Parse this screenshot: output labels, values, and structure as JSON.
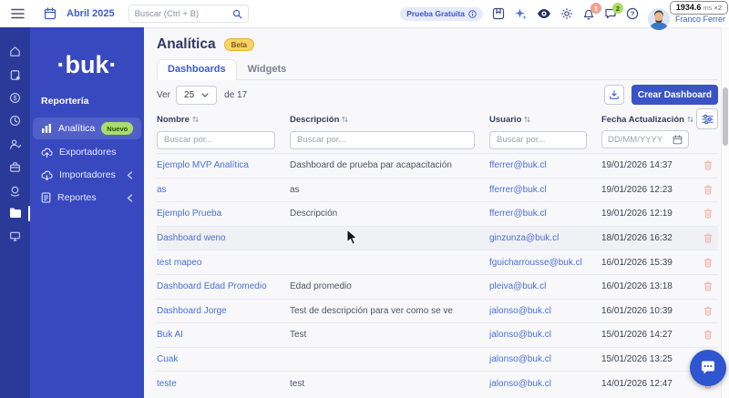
{
  "perf_overlay": {
    "value": "1934.6",
    "unit": "ms",
    "mult": "×2"
  },
  "topbar": {
    "date_label": "Abril 2025",
    "search_placeholder": "Buscar (Ctrl + B)",
    "trial_badge": "Prueba Gratuita",
    "notification_count": "1",
    "messages_count": "2",
    "user_name": "Franco Ferrer"
  },
  "sidebar": {
    "logo_text": "·buk·",
    "section_label": "Reportería",
    "items": [
      {
        "label": "Analítica",
        "badge": "Nuevo"
      },
      {
        "label": "Exportadores"
      },
      {
        "label": "Importadores"
      },
      {
        "label": "Reportes"
      }
    ]
  },
  "main": {
    "title": "Analítica",
    "beta_badge": "Beta",
    "tab_dashboards": "Dashboards",
    "tab_widgets": "Widgets",
    "ver_label": "Ver",
    "page_size": "25",
    "total_label": "de 17",
    "create_button_label": "Crear Dashboard"
  },
  "table": {
    "headers": {
      "nombre": "Nombre",
      "descripcion": "Descripción",
      "usuario": "Usuario",
      "fecha": "Fecha Actualización"
    },
    "filter_placeholder": "Buscar por...",
    "date_placeholder": "DD/MM/YYYY",
    "hover_row_index": 3,
    "rows": [
      {
        "nombre": "Ejemplo MVP Analítica",
        "descripcion": "Dashboard de prueba par acapacitación",
        "usuario": "fferrer@buk.cl",
        "fecha": "19/01/2026 14:37"
      },
      {
        "nombre": "as",
        "descripcion": "as",
        "usuario": "fferrer@buk.cl",
        "fecha": "19/01/2026 12:23"
      },
      {
        "nombre": "Ejemplo Prueba",
        "descripcion": "Descripción",
        "usuario": "fferrer@buk.cl",
        "fecha": "19/01/2026 12:19"
      },
      {
        "nombre": "Dashboard weno",
        "descripcion": "",
        "usuario": "ginzunza@buk.cl",
        "fecha": "18/01/2026 16:32"
      },
      {
        "nombre": "test mapeo",
        "descripcion": "",
        "usuario": "fguicharrousse@buk.cl",
        "fecha": "16/01/2026 15:39"
      },
      {
        "nombre": "Dashboard Edad Promedio",
        "descripcion": "Edad promedio",
        "usuario": "pleiva@buk.cl",
        "fecha": "16/01/2026 13:18"
      },
      {
        "nombre": "Dashboard Jorge",
        "descripcion": "Test de descripción para ver como se ve",
        "usuario": "jalonso@buk.cl",
        "fecha": "16/01/2026 10:39"
      },
      {
        "nombre": "Buk AI",
        "descripcion": "Test",
        "usuario": "jalonso@buk.cl",
        "fecha": "15/01/2026 14:27"
      },
      {
        "nombre": "Cuak",
        "descripcion": "",
        "usuario": "jalonso@buk.cl",
        "fecha": "15/01/2026 13:25"
      },
      {
        "nombre": "teste",
        "descripcion": "test",
        "usuario": "jalonso@buk.cl",
        "fecha": "14/01/2026 12:47"
      }
    ]
  },
  "colors": {
    "accent": "#3a53c5",
    "sidebar_rail": "#2b3a99",
    "sidebar_panel": "#3849c0",
    "nuevo_badge": "#a9dc6d",
    "beta_badge": "#fbd267",
    "link": "#4a6fd6",
    "trash": "#f2a9a2"
  }
}
